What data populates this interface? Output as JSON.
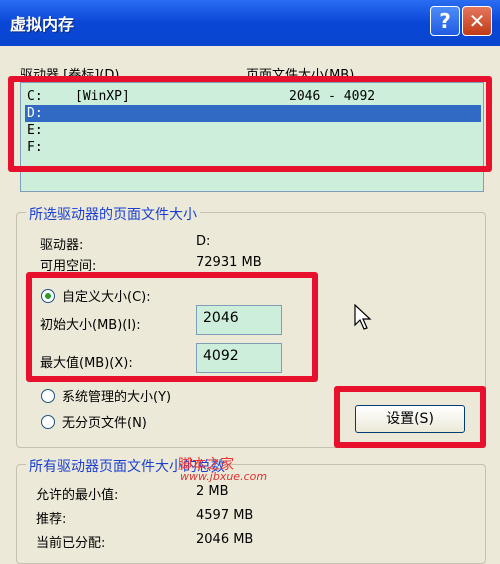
{
  "window": {
    "title": "虚拟内存",
    "help_icon": "?",
    "close_icon": "✕"
  },
  "drive_list": {
    "header_drive": "驱动器 [卷标](D)",
    "header_pagefile": "页面文件大小(MB)",
    "rows": [
      {
        "drive": "C:",
        "label": "[WinXP]",
        "size": "2046 - 4092"
      },
      {
        "drive": "D:",
        "label": "",
        "size": "",
        "selected": true
      },
      {
        "drive": "E:",
        "label": "",
        "size": ""
      },
      {
        "drive": "F:",
        "label": "",
        "size": ""
      }
    ]
  },
  "selected_drive_group": {
    "title": "所选驱动器的页面文件大小",
    "drive_label": "驱动器:",
    "drive_value": "D:",
    "space_label": "可用空间:",
    "space_value": "72931 MB",
    "custom_size_label": "自定义大小(C):",
    "initial_label": "初始大小(MB)(I):",
    "initial_value": "2046",
    "max_label": "最大值(MB)(X):",
    "max_value": "4092",
    "system_managed_label": "系统管理的大小(Y)",
    "no_paging_label": "无分页文件(N)",
    "set_button": "设置(S)"
  },
  "all_drives_group": {
    "title": "所有驱动器页面文件大小的总数",
    "min_label": "允许的最小值:",
    "min_value": "2 MB",
    "recommended_label": "推荐:",
    "recommended_value": "4597 MB",
    "allocated_label": "当前已分配:",
    "allocated_value": "2046 MB"
  },
  "watermark": {
    "text": "脚本之家",
    "url": "www.jbxue.com"
  },
  "colors": {
    "title_bar": "#0846cf",
    "list_bg": "#cdeedb",
    "highlight": "#316ac5",
    "red_annotation": "#e8112d"
  }
}
